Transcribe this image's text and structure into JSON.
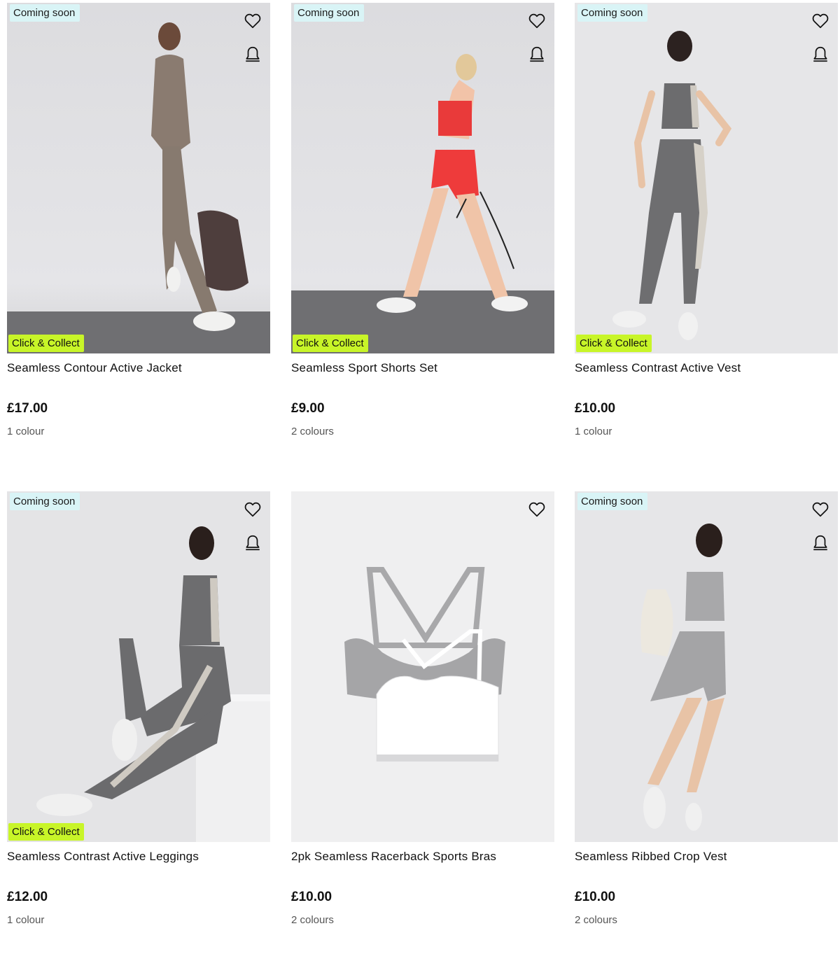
{
  "products": [
    {
      "title": "Seamless Contour Active Jacket",
      "price": "£17.00",
      "colours": "1 colour",
      "coming_soon": "Coming soon",
      "click_collect": "Click & Collect",
      "image_desc": "woman-in-taupe-jacket-and-leggings"
    },
    {
      "title": "Seamless Sport Shorts Set",
      "price": "£9.00",
      "colours": "2 colours",
      "coming_soon": "Coming soon",
      "click_collect": "Click & Collect",
      "image_desc": "woman-in-red-shorts-set-with-skipping-rope"
    },
    {
      "title": "Seamless Contrast Active Vest",
      "price": "£10.00",
      "colours": "1 colour",
      "coming_soon": "Coming soon",
      "click_collect": "Click & Collect",
      "image_desc": "woman-in-grey-vest-and-leggings"
    },
    {
      "title": "Seamless Contrast Active Leggings",
      "price": "£12.00",
      "colours": "1 colour",
      "coming_soon": "Coming soon",
      "click_collect": "Click & Collect",
      "image_desc": "woman-sitting-on-block-in-grey-leggings"
    },
    {
      "title": "2pk Seamless Racerback Sports Bras",
      "price": "£10.00",
      "colours": "2 colours",
      "image_desc": "grey-and-white-sports-bras-flatlay"
    },
    {
      "title": "Seamless Ribbed Crop Vest",
      "price": "£10.00",
      "colours": "2 colours",
      "coming_soon": "Coming soon",
      "image_desc": "woman-in-grey-crop-vest-and-shorts-with-bag"
    }
  ],
  "colors": {
    "coming_soon_bg": "#d9f4f6",
    "click_collect_bg": "#c8f528"
  },
  "icons": {
    "wishlist": "heart-icon",
    "notify": "bell-icon"
  }
}
